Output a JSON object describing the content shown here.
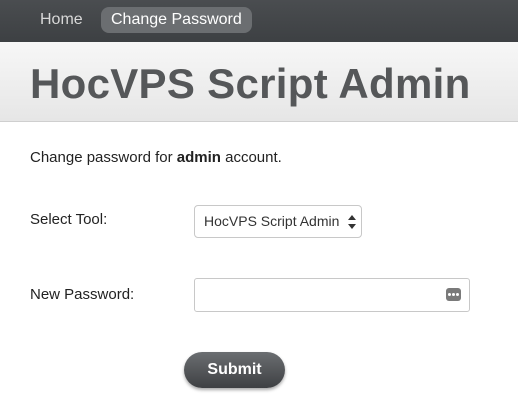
{
  "nav": {
    "items": [
      {
        "label": "Home",
        "active": false
      },
      {
        "label": "Change Password",
        "active": true
      }
    ]
  },
  "header": {
    "title": "HocVPS Script Admin"
  },
  "intro": {
    "prefix": "Change password for ",
    "username": "admin",
    "suffix": " account."
  },
  "form": {
    "tool_label": "Select Tool:",
    "tool_selected": "HocVPS Script Admin",
    "password_label": "New Password:",
    "password_value": "",
    "submit_label": "Submit"
  },
  "icons": {
    "select": "up-down-arrows-icon",
    "password_field": "password-manager-icon"
  },
  "colors": {
    "nav_bg": "#3d4043",
    "nav_active_bg": "#6b6e71",
    "title": "#555759",
    "button_bg": "#3e4043"
  }
}
